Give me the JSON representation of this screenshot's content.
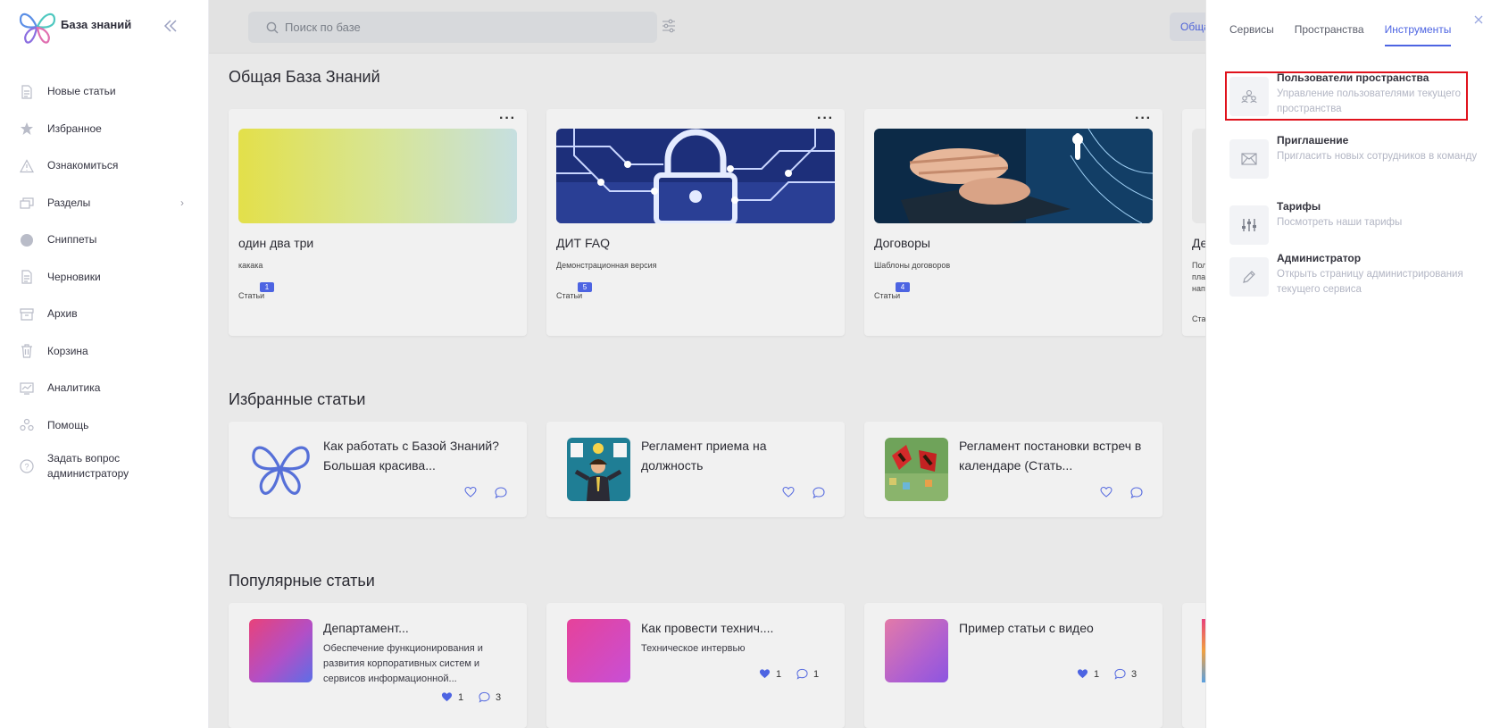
{
  "app": {
    "title": "База знаний"
  },
  "sidebar": {
    "items": [
      {
        "label": "Новые статьи",
        "icon": "document-icon"
      },
      {
        "label": "Избранное",
        "icon": "star-icon"
      },
      {
        "label": "Ознакомиться",
        "icon": "warning-icon"
      },
      {
        "label": "Разделы",
        "icon": "sections-icon"
      },
      {
        "label": "Сниппеты",
        "icon": "circle-icon"
      },
      {
        "label": "Черновики",
        "icon": "draft-icon"
      },
      {
        "label": "Архив",
        "icon": "archive-icon"
      },
      {
        "label": "Корзина",
        "icon": "trash-icon"
      },
      {
        "label": "Аналитика",
        "icon": "analytics-icon"
      },
      {
        "label": "Помощь",
        "icon": "help-icon"
      },
      {
        "label": "Задать вопрос администратору",
        "icon": "question-icon"
      }
    ]
  },
  "topbar": {
    "search_placeholder": "Поиск по базе",
    "space_button": "Общая"
  },
  "main": {
    "kb_title": "Общая База Знаний",
    "kb_cards": [
      {
        "title": "один два три",
        "desc": "какака",
        "count": "1",
        "count_label": "Статьи"
      },
      {
        "title": "ДИТ FAQ",
        "desc": "Демонстрационная версия",
        "count": "5",
        "count_label": "Статьи"
      },
      {
        "title": "Договоры",
        "desc": "Шаблоны договоров",
        "count": "4",
        "count_label": "Статьи"
      },
      {
        "title": "Де",
        "desc": "Пол пла нап",
        "count": "",
        "count_label": "Ста"
      }
    ],
    "favorites_title": "Избранные статьи",
    "favorites": [
      {
        "title": "Как работать с Базой Знаний? Большая красива..."
      },
      {
        "title": "Регламент приема на должность"
      },
      {
        "title": "Регламент постановки встреч в календаре (Стать..."
      }
    ],
    "popular_title": "Популярные статьи",
    "popular": [
      {
        "title": "Департамент...",
        "desc": "Обеспечение функционирования и развития корпоративных систем и сервисов информационной...",
        "likes": "1",
        "comments": "3"
      },
      {
        "title": "Как провести технич....",
        "desc": "Техническое интервью",
        "likes": "1",
        "comments": "1"
      },
      {
        "title": "Пример статьи с видео",
        "desc": "",
        "likes": "1",
        "comments": "3"
      }
    ]
  },
  "panel": {
    "tabs": [
      "Сервисы",
      "Пространства",
      "Инструменты"
    ],
    "active_tab": "Инструменты",
    "tools": [
      {
        "title": "Пользователи пространства",
        "desc": "Управление пользователями текущего пространства",
        "icon": "users-icon"
      },
      {
        "title": "Приглашение",
        "desc": "Пригласить новых сотрудников в команду",
        "icon": "envelope-icon"
      },
      {
        "title": "Тарифы",
        "desc": "Посмотреть наши тарифы",
        "icon": "sliders-icon"
      },
      {
        "title": "Администратор",
        "desc": "Открыть страницу администрирования текущего сервиса",
        "icon": "pencil-icon"
      }
    ]
  },
  "colors": {
    "accent": "#4d64e2",
    "highlight": "#e0121c"
  }
}
